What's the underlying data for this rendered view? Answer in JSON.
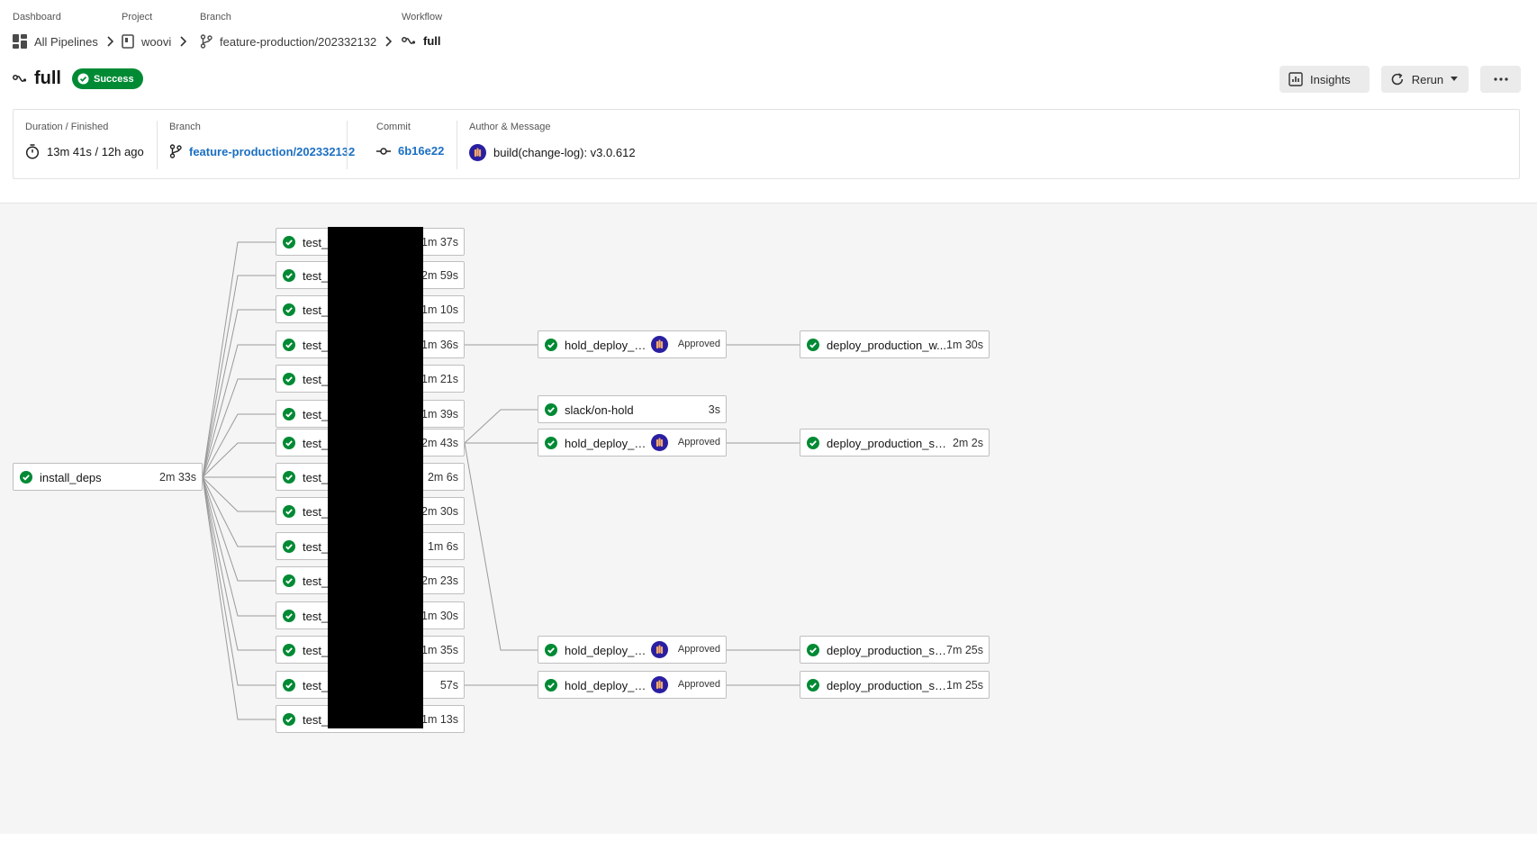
{
  "breadcrumbs": [
    {
      "label": "Dashboard",
      "value": "All Pipelines",
      "icon": "dashboard-icon"
    },
    {
      "label": "Project",
      "value": "woovi",
      "icon": "repo-icon"
    },
    {
      "label": "Branch",
      "value": "feature-production/202332132",
      "icon": "branch-icon"
    },
    {
      "label": "Workflow",
      "value": "full",
      "icon": "workflow-icon"
    }
  ],
  "workflow": {
    "title": "full",
    "status": "Success"
  },
  "actions": {
    "insights": "Insights",
    "rerun": "Rerun"
  },
  "summary": {
    "duration_label": "Duration / Finished",
    "duration_value": "13m 41s / 12h ago",
    "branch_label": "Branch",
    "branch_value": "feature-production/202332132",
    "commit_label": "Commit",
    "commit_value": "6b16e22",
    "author_label": "Author & Message",
    "author_message": "build(change-log): v3.0.612"
  },
  "colors": {
    "success": "#008a34",
    "link": "#1b6fc2",
    "avatar": "#2a1fa0"
  },
  "jobs": {
    "install_deps": {
      "name": "install_deps",
      "time": "2m 33s"
    },
    "tests": [
      {
        "name": "test_",
        "time": "1m 37s"
      },
      {
        "name": "test_",
        "time": "2m 59s"
      },
      {
        "name": "test_",
        "time": "1m 10s"
      },
      {
        "name": "test_",
        "time": "1m 36s"
      },
      {
        "name": "test_",
        "time": "1m 21s"
      },
      {
        "name": "test_",
        "time": "1m 39s"
      },
      {
        "name": "test_",
        "time": "2m 43s"
      },
      {
        "name": "test_",
        "time": "2m 6s"
      },
      {
        "name": "test_",
        "time": "2m 30s"
      },
      {
        "name": "test_",
        "time": "1m 6s"
      },
      {
        "name": "test_",
        "time": "2m 23s"
      },
      {
        "name": "test_",
        "time": "1m 30s"
      },
      {
        "name": "test_",
        "time": "1m 35s"
      },
      {
        "name": "test_",
        "time": "57s"
      },
      {
        "name": "test_",
        "time": "1m 13s"
      }
    ],
    "holds": [
      {
        "name": "hold_deploy_pr...",
        "status": "Approved"
      },
      {
        "name": "slack/on-hold",
        "time": "3s"
      },
      {
        "name": "hold_deploy_pr...",
        "status": "Approved"
      },
      {
        "name": "hold_deploy_pr...",
        "status": "Approved"
      },
      {
        "name": "hold_deploy_pr...",
        "status": "Approved"
      }
    ],
    "deploys": [
      {
        "name": "deploy_production_w...",
        "time": "1m 30s"
      },
      {
        "name": "deploy_production_ser...",
        "time": "2m 2s"
      },
      {
        "name": "deploy_production_se...",
        "time": "7m 25s"
      },
      {
        "name": "deploy_production_sh...",
        "time": "1m 25s"
      }
    ]
  }
}
